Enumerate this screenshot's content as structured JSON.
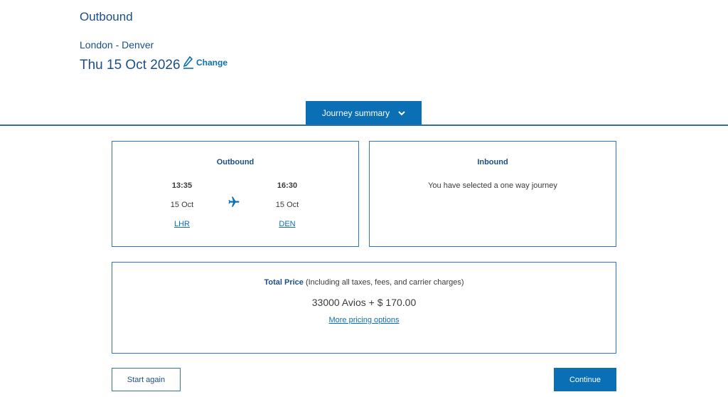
{
  "header": {
    "title": "Outbound",
    "route": "London - Denver",
    "date": "Thu 15 Oct 2026",
    "change_label": "Change"
  },
  "summary_tab": {
    "label": "Journey summary"
  },
  "outbound_card": {
    "title": "Outbound",
    "departure": {
      "time": "13:35",
      "date": "15 Oct",
      "code": "LHR"
    },
    "arrival": {
      "time": "16:30",
      "date": "15 Oct",
      "code": "DEN"
    }
  },
  "inbound_card": {
    "title": "Inbound",
    "message": "You have selected a one way journey"
  },
  "price_card": {
    "label_bold": "Total Price",
    "label_rest": " (Including all taxes, fees, and carrier charges)",
    "value": "33000 Avios + $ 170.00",
    "link": "More pricing options"
  },
  "buttons": {
    "start_again": "Start again",
    "continue": "Continue"
  },
  "colors": {
    "accent": "#0b6fb5",
    "heading": "#1b4f8a",
    "border": "#2f77b6"
  }
}
